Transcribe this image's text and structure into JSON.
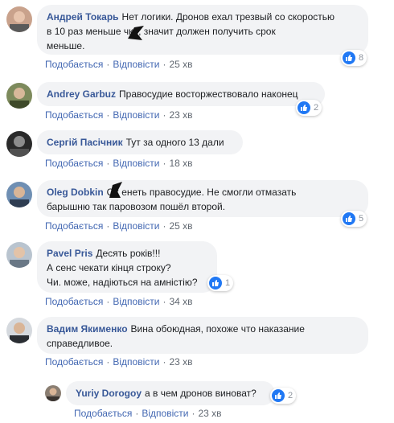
{
  "colors": {
    "author": "#385898",
    "link": "#4267b2",
    "bubble": "#f2f3f5",
    "meta": "#606770",
    "like": "#2078f4"
  },
  "actions": {
    "like_ru": "Подобається",
    "reply": "Відповісти",
    "separator": "·"
  },
  "comments": [
    {
      "author": "Андрей Токарь",
      "text": "Нет логики. Дронов ехал трезвый со скоростью\nв 10 раз меньше      чки, значит должен получить срок\nменьше.",
      "time": "25 хв",
      "reactions": "8"
    },
    {
      "author": "Andrey Garbuz",
      "text": "Правосудие восторжествовало наконец",
      "time": "23 хв",
      "reactions": "2"
    },
    {
      "author": "Сергій Пасічник",
      "text": "Тут за одного 13 дали",
      "time": "18 хв",
      "reactions": ""
    },
    {
      "author": "Oleg Dobkin",
      "text": "Ох      енеть правосудие. Не смогли отмазать\nбарышню так паровозом пошёл второй.",
      "time": "25 хв",
      "reactions": "5"
    },
    {
      "author": "Pavel Pris",
      "text": "Десять років!!!\nА сенс чекати кінця строку?\nЧи. може, надіються на амністію?",
      "time": "34 хв",
      "reactions": "1"
    },
    {
      "author": "Вадим Якименко",
      "text": "Вина обоюдная, похоже что наказание\nсправедливое.",
      "time": "23 хв",
      "reactions": ""
    },
    {
      "author": "Yuriy Dorogoy",
      "text": "а в чем дронов виноват?",
      "time": "23 хв",
      "reactions": "2"
    }
  ]
}
